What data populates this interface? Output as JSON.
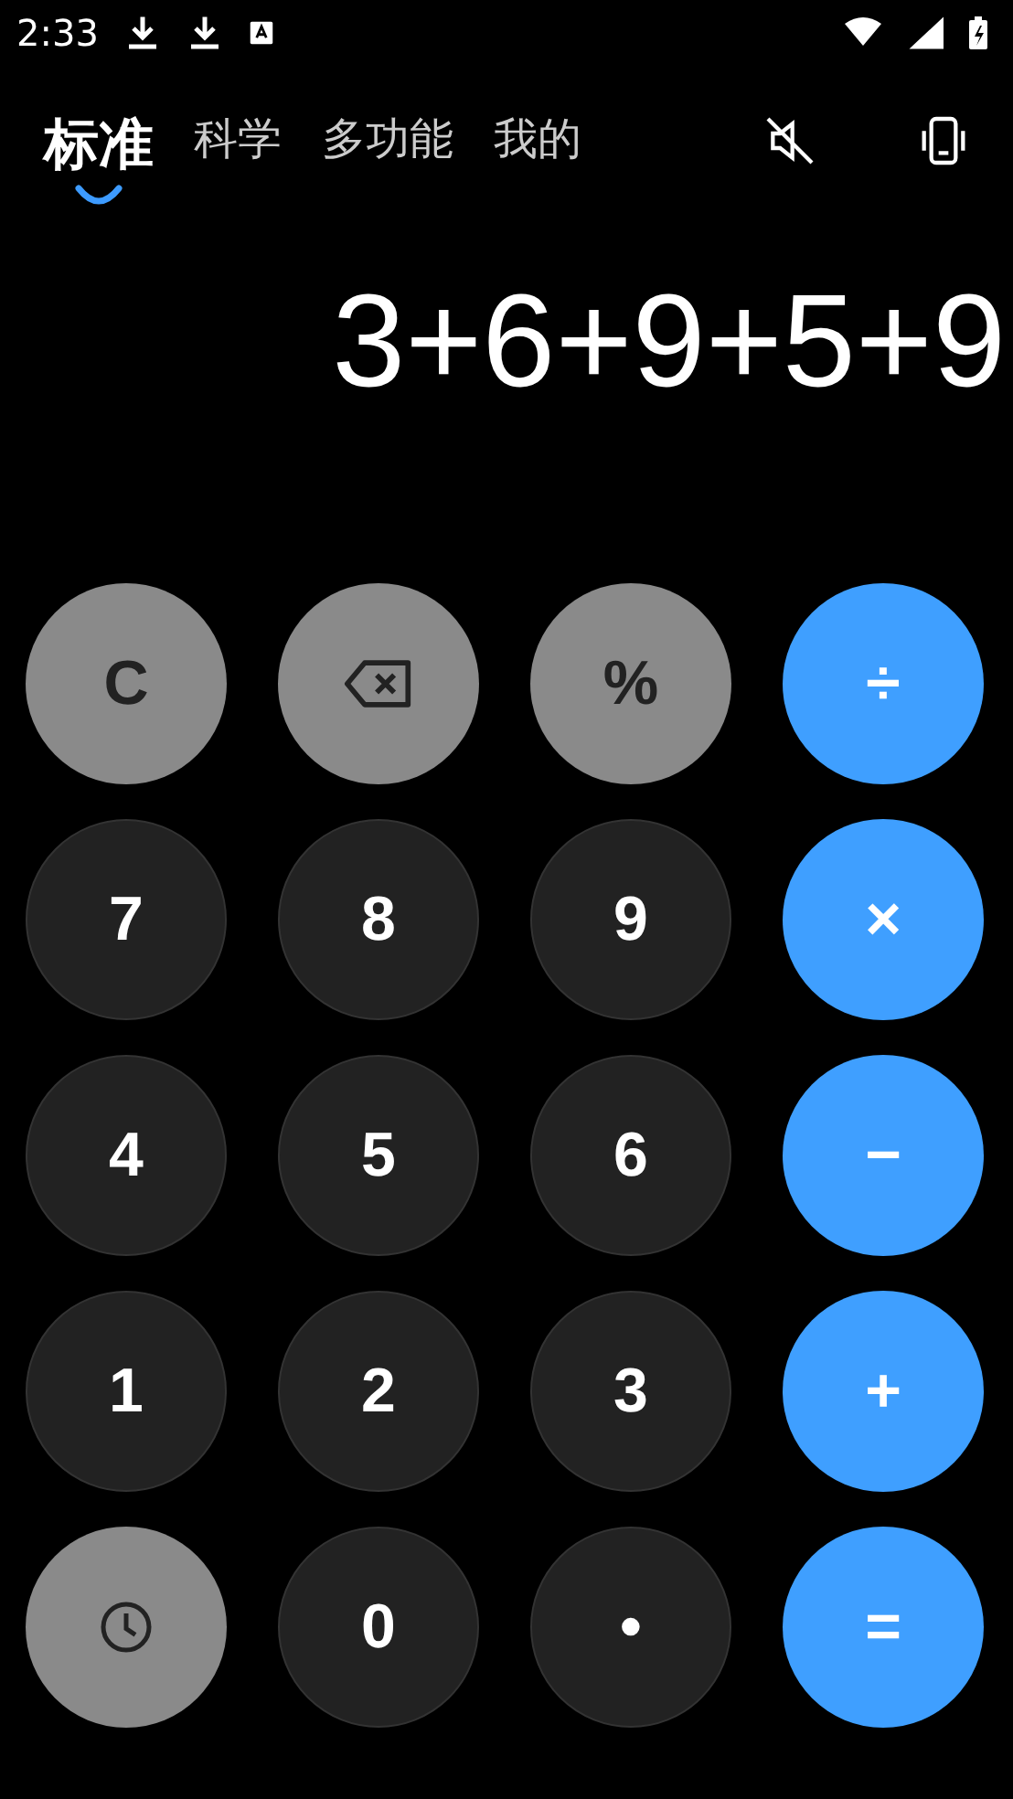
{
  "status_bar": {
    "time": "2:33"
  },
  "tabs": [
    {
      "label": "标准",
      "selected": true
    },
    {
      "label": "科学",
      "selected": false
    },
    {
      "label": "多功能",
      "selected": false
    },
    {
      "label": "我的",
      "selected": false
    }
  ],
  "display": {
    "expression": "3+6+9+5+9"
  },
  "keys": [
    {
      "label": "C",
      "kind": "func"
    },
    {
      "kind": "backspace"
    },
    {
      "label": "%",
      "kind": "func"
    },
    {
      "label": "÷",
      "kind": "op"
    },
    {
      "label": "7",
      "kind": "digit"
    },
    {
      "label": "8",
      "kind": "digit"
    },
    {
      "label": "9",
      "kind": "digit"
    },
    {
      "label": "×",
      "kind": "op"
    },
    {
      "label": "4",
      "kind": "digit"
    },
    {
      "label": "5",
      "kind": "digit"
    },
    {
      "label": "6",
      "kind": "digit"
    },
    {
      "label": "−",
      "kind": "op"
    },
    {
      "label": "1",
      "kind": "digit"
    },
    {
      "label": "2",
      "kind": "digit"
    },
    {
      "label": "3",
      "kind": "digit"
    },
    {
      "label": "+",
      "kind": "op"
    },
    {
      "kind": "history"
    },
    {
      "label": "0",
      "kind": "digit"
    },
    {
      "label": "•",
      "kind": "digit"
    },
    {
      "label": "=",
      "kind": "op"
    }
  ]
}
